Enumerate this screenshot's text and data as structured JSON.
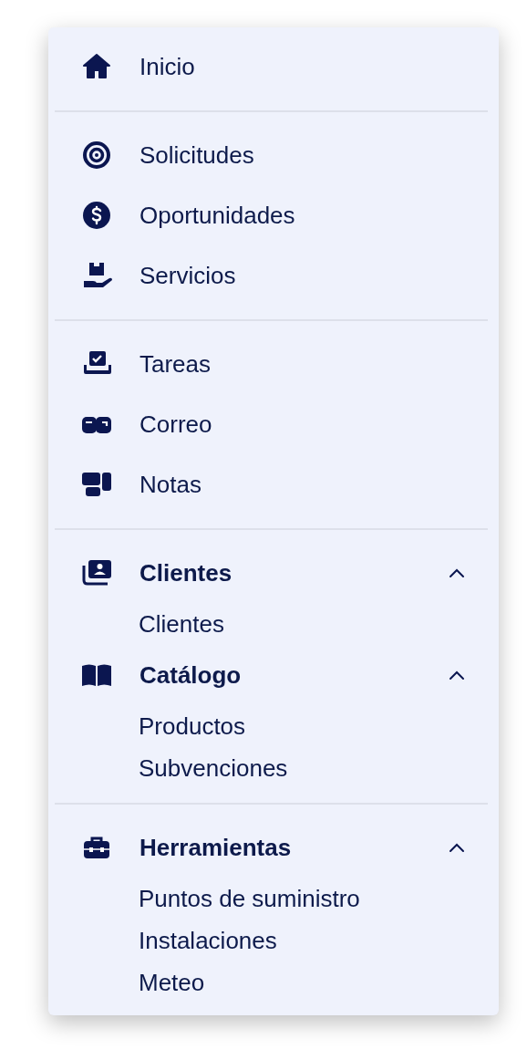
{
  "sections": [
    {
      "items": [
        {
          "kind": "link",
          "label": "Inicio"
        }
      ]
    },
    {
      "items": [
        {
          "kind": "link",
          "label": "Solicitudes"
        },
        {
          "kind": "link",
          "label": "Oportunidades"
        },
        {
          "kind": "link",
          "label": "Servicios"
        }
      ]
    },
    {
      "items": [
        {
          "kind": "link",
          "label": "Tareas"
        },
        {
          "kind": "link",
          "label": "Correo"
        },
        {
          "kind": "link",
          "label": "Notas"
        }
      ]
    },
    {
      "items": [
        {
          "kind": "group",
          "label": "Clientes",
          "expanded": true,
          "children": [
            {
              "label": "Clientes"
            }
          ]
        },
        {
          "kind": "group",
          "label": "Catálogo",
          "expanded": true,
          "children": [
            {
              "label": "Productos"
            },
            {
              "label": "Subvenciones"
            }
          ]
        }
      ]
    },
    {
      "items": [
        {
          "kind": "group",
          "label": "Herramientas",
          "expanded": true,
          "children": [
            {
              "label": "Puntos de suministro"
            },
            {
              "label": "Instalaciones"
            },
            {
              "label": "Meteo"
            }
          ]
        }
      ]
    }
  ]
}
